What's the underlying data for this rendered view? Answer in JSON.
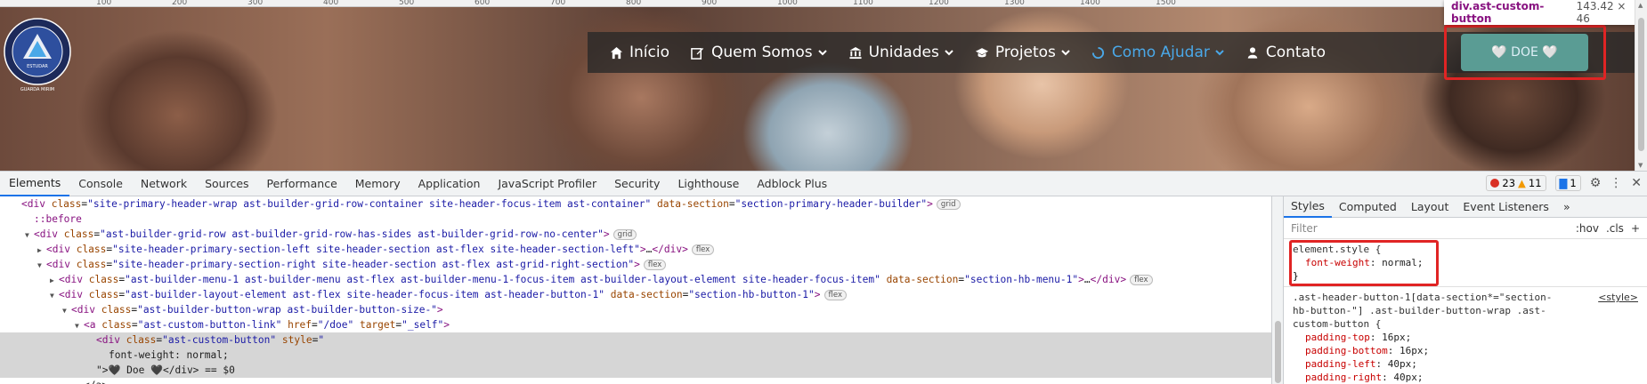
{
  "ruler": {
    "ticks": [
      "100",
      "200",
      "300",
      "400",
      "500",
      "600",
      "700",
      "800",
      "900",
      "1000",
      "1100",
      "1200",
      "1300",
      "1400",
      "1500"
    ]
  },
  "site": {
    "logo_top_text": "ENSINO EDUCACIONAL • ESPAÇO DE ESTUDAR",
    "logo_mid_text": "ESTUDAR",
    "logo_bottom_text": "GUARDA MIRIM",
    "nav": [
      {
        "label": "Início",
        "icon": "home-icon",
        "dropdown": false,
        "active": false
      },
      {
        "label": "Quem Somos",
        "icon": "edit-icon",
        "dropdown": true,
        "active": false
      },
      {
        "label": "Unidades",
        "icon": "bank-icon",
        "dropdown": true,
        "active": false
      },
      {
        "label": "Projetos",
        "icon": "graduation-cap-icon",
        "dropdown": true,
        "active": false
      },
      {
        "label": "Como Ajudar",
        "icon": "spinner-icon",
        "dropdown": true,
        "active": true
      },
      {
        "label": "Contato",
        "icon": "user-icon",
        "dropdown": false,
        "active": false
      }
    ],
    "doe_button": {
      "label": "🤍 DOE 🤍"
    },
    "accent_color": "#4aa8e8",
    "doe_color": "#5a9c94"
  },
  "tooltip": {
    "selector": "div.ast-custom-button",
    "size": "143.42 × 46"
  },
  "devtools": {
    "tabs": [
      "Elements",
      "Console",
      "Network",
      "Sources",
      "Performance",
      "Memory",
      "Application",
      "JavaScript Profiler",
      "Security",
      "Lighthouse",
      "Adblock Plus"
    ],
    "active_tab": "Elements",
    "errors": "23",
    "warnings": "11",
    "messages": "1",
    "dom_lines": [
      {
        "indent": 0,
        "html": "<div class=\"site-primary-header-wrap ast-builder-grid-row-container site-header-focus-item ast-container\" data-section=\"section-primary-header-builder\">",
        "ann": "grid",
        "tri": ""
      },
      {
        "indent": 1,
        "text": "::before",
        "tri": ""
      },
      {
        "indent": 1,
        "html": "<div class=\"ast-builder-grid-row ast-builder-grid-row-has-sides ast-builder-grid-row-no-center\">",
        "ann": "grid",
        "tri": "▼"
      },
      {
        "indent": 2,
        "html": "<div class=\"site-header-primary-section-left site-header-section ast-flex site-header-section-left\">…</div>",
        "ann": "flex",
        "tri": "▶"
      },
      {
        "indent": 2,
        "html": "<div class=\"site-header-primary-section-right site-header-section ast-flex ast-grid-right-section\">",
        "ann": "flex",
        "tri": "▼"
      },
      {
        "indent": 3,
        "html": "<div class=\"ast-builder-menu-1 ast-builder-menu ast-flex ast-builder-menu-1-focus-item ast-builder-layout-element site-header-focus-item\" data-section=\"section-hb-menu-1\">…</div>",
        "ann": "flex",
        "tri": "▶"
      },
      {
        "indent": 3,
        "html": "<div class=\"ast-builder-layout-element ast-flex site-header-focus-item ast-header-button-1\" data-section=\"section-hb-button-1\">",
        "ann": "flex",
        "tri": "▼"
      },
      {
        "indent": 4,
        "html": "<div class=\"ast-builder-button-wrap ast-builder-button-size-\">",
        "ann": "",
        "tri": "▼"
      },
      {
        "indent": 5,
        "html": "<a class=\"ast-custom-button-link\" href=\"/doe\" target=\"_self\">",
        "ann": "",
        "tri": "▼"
      },
      {
        "indent": 6,
        "html": "<div class=\"ast-custom-button\" style=\"",
        "ann": "",
        "tri": "",
        "selected": true
      },
      {
        "indent": 7,
        "text": "font-weight: normal;",
        "tri": "",
        "selected": true
      },
      {
        "indent": 6,
        "text": "\">🖤 Doe 🖤</div> == $0",
        "tri": "",
        "selected": true
      },
      {
        "indent": 5,
        "text": "</a>",
        "tri": ""
      }
    ],
    "styles_tabs": [
      "Styles",
      "Computed",
      "Layout",
      "Event Listeners",
      "»"
    ],
    "styles_active": "Styles",
    "filter_placeholder": "Filter",
    "filter_buttons": [
      ":hov",
      ".cls",
      "+"
    ],
    "element_style": {
      "selector": "element.style {",
      "prop": "font-weight",
      "value": "normal;",
      "close": "}"
    },
    "rule2": {
      "selector": ".ast-header-button-1[data-section*=\"section-hb-button-\"] .ast-builder-button-wrap .ast-custom-button {",
      "source": "<style>",
      "props": [
        {
          "prop": "padding-top",
          "value": "16px;"
        },
        {
          "prop": "padding-bottom",
          "value": "16px;"
        },
        {
          "prop": "padding-left",
          "value": "40px;"
        },
        {
          "prop": "padding-right",
          "value": "40px;"
        }
      ],
      "close": "}"
    }
  }
}
